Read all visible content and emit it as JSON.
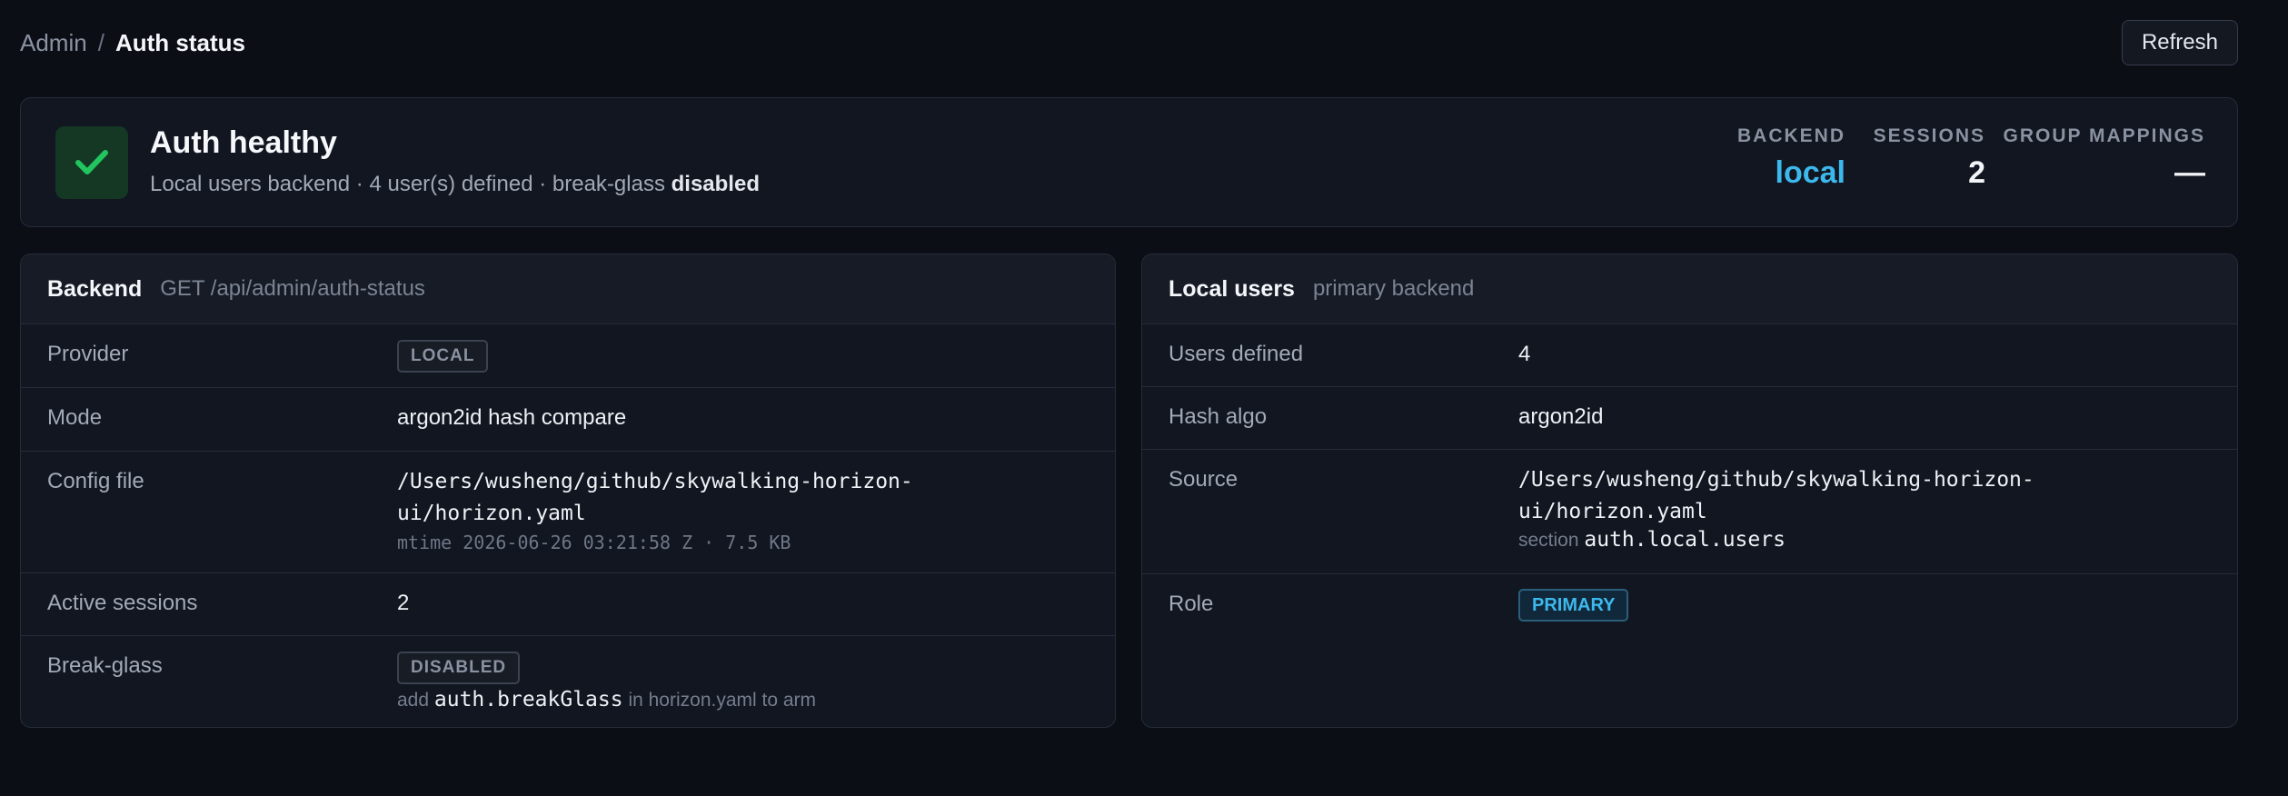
{
  "breadcrumb": {
    "parent": "Admin",
    "separator": "/",
    "current": "Auth status"
  },
  "toolbar": {
    "refresh_label": "Refresh"
  },
  "banner": {
    "status_icon": "check-icon",
    "status_color": "#22c55e",
    "title": "Auth healthy",
    "subtitle_prefix": "Local users backend · 4 user(s) defined · break-glass",
    "subtitle_strong": "disabled",
    "stats": [
      {
        "label": "BACKEND",
        "value": "local",
        "accent": "#3db8ec"
      },
      {
        "label": "SESSIONS",
        "value": "2"
      },
      {
        "label": "GROUP MAPPINGS",
        "value": "—"
      }
    ]
  },
  "backend_panel": {
    "title": "Backend",
    "subtitle": "GET /api/admin/auth-status",
    "rows": {
      "provider": {
        "label": "Provider",
        "badge": "LOCAL"
      },
      "mode": {
        "label": "Mode",
        "value": "argon2id hash compare"
      },
      "config_file": {
        "label": "Config file",
        "path_line1": "/Users/wusheng/github/skywalking-horizon-",
        "path_line2": "ui/horizon.yaml",
        "meta": "mtime 2026-06-26 03:21:58 Z · 7.5 KB"
      },
      "active_sessions": {
        "label": "Active sessions",
        "value": "2"
      },
      "break_glass": {
        "label": "Break-glass",
        "badge": "DISABLED",
        "hint_prefix": "add",
        "hint_code": "auth.breakGlass",
        "hint_suffix": "in horizon.yaml to arm"
      }
    }
  },
  "local_users_panel": {
    "title": "Local users",
    "subtitle": "primary backend",
    "rows": {
      "users_defined": {
        "label": "Users defined",
        "value": "4"
      },
      "hash_algo": {
        "label": "Hash algo",
        "value": "argon2id"
      },
      "source": {
        "label": "Source",
        "path_line1": "/Users/wusheng/github/skywalking-horizon-",
        "path_line2": "ui/horizon.yaml",
        "section_label": "section",
        "section_value": "auth.local.users"
      },
      "role": {
        "label": "Role",
        "badge": "PRIMARY"
      }
    }
  }
}
